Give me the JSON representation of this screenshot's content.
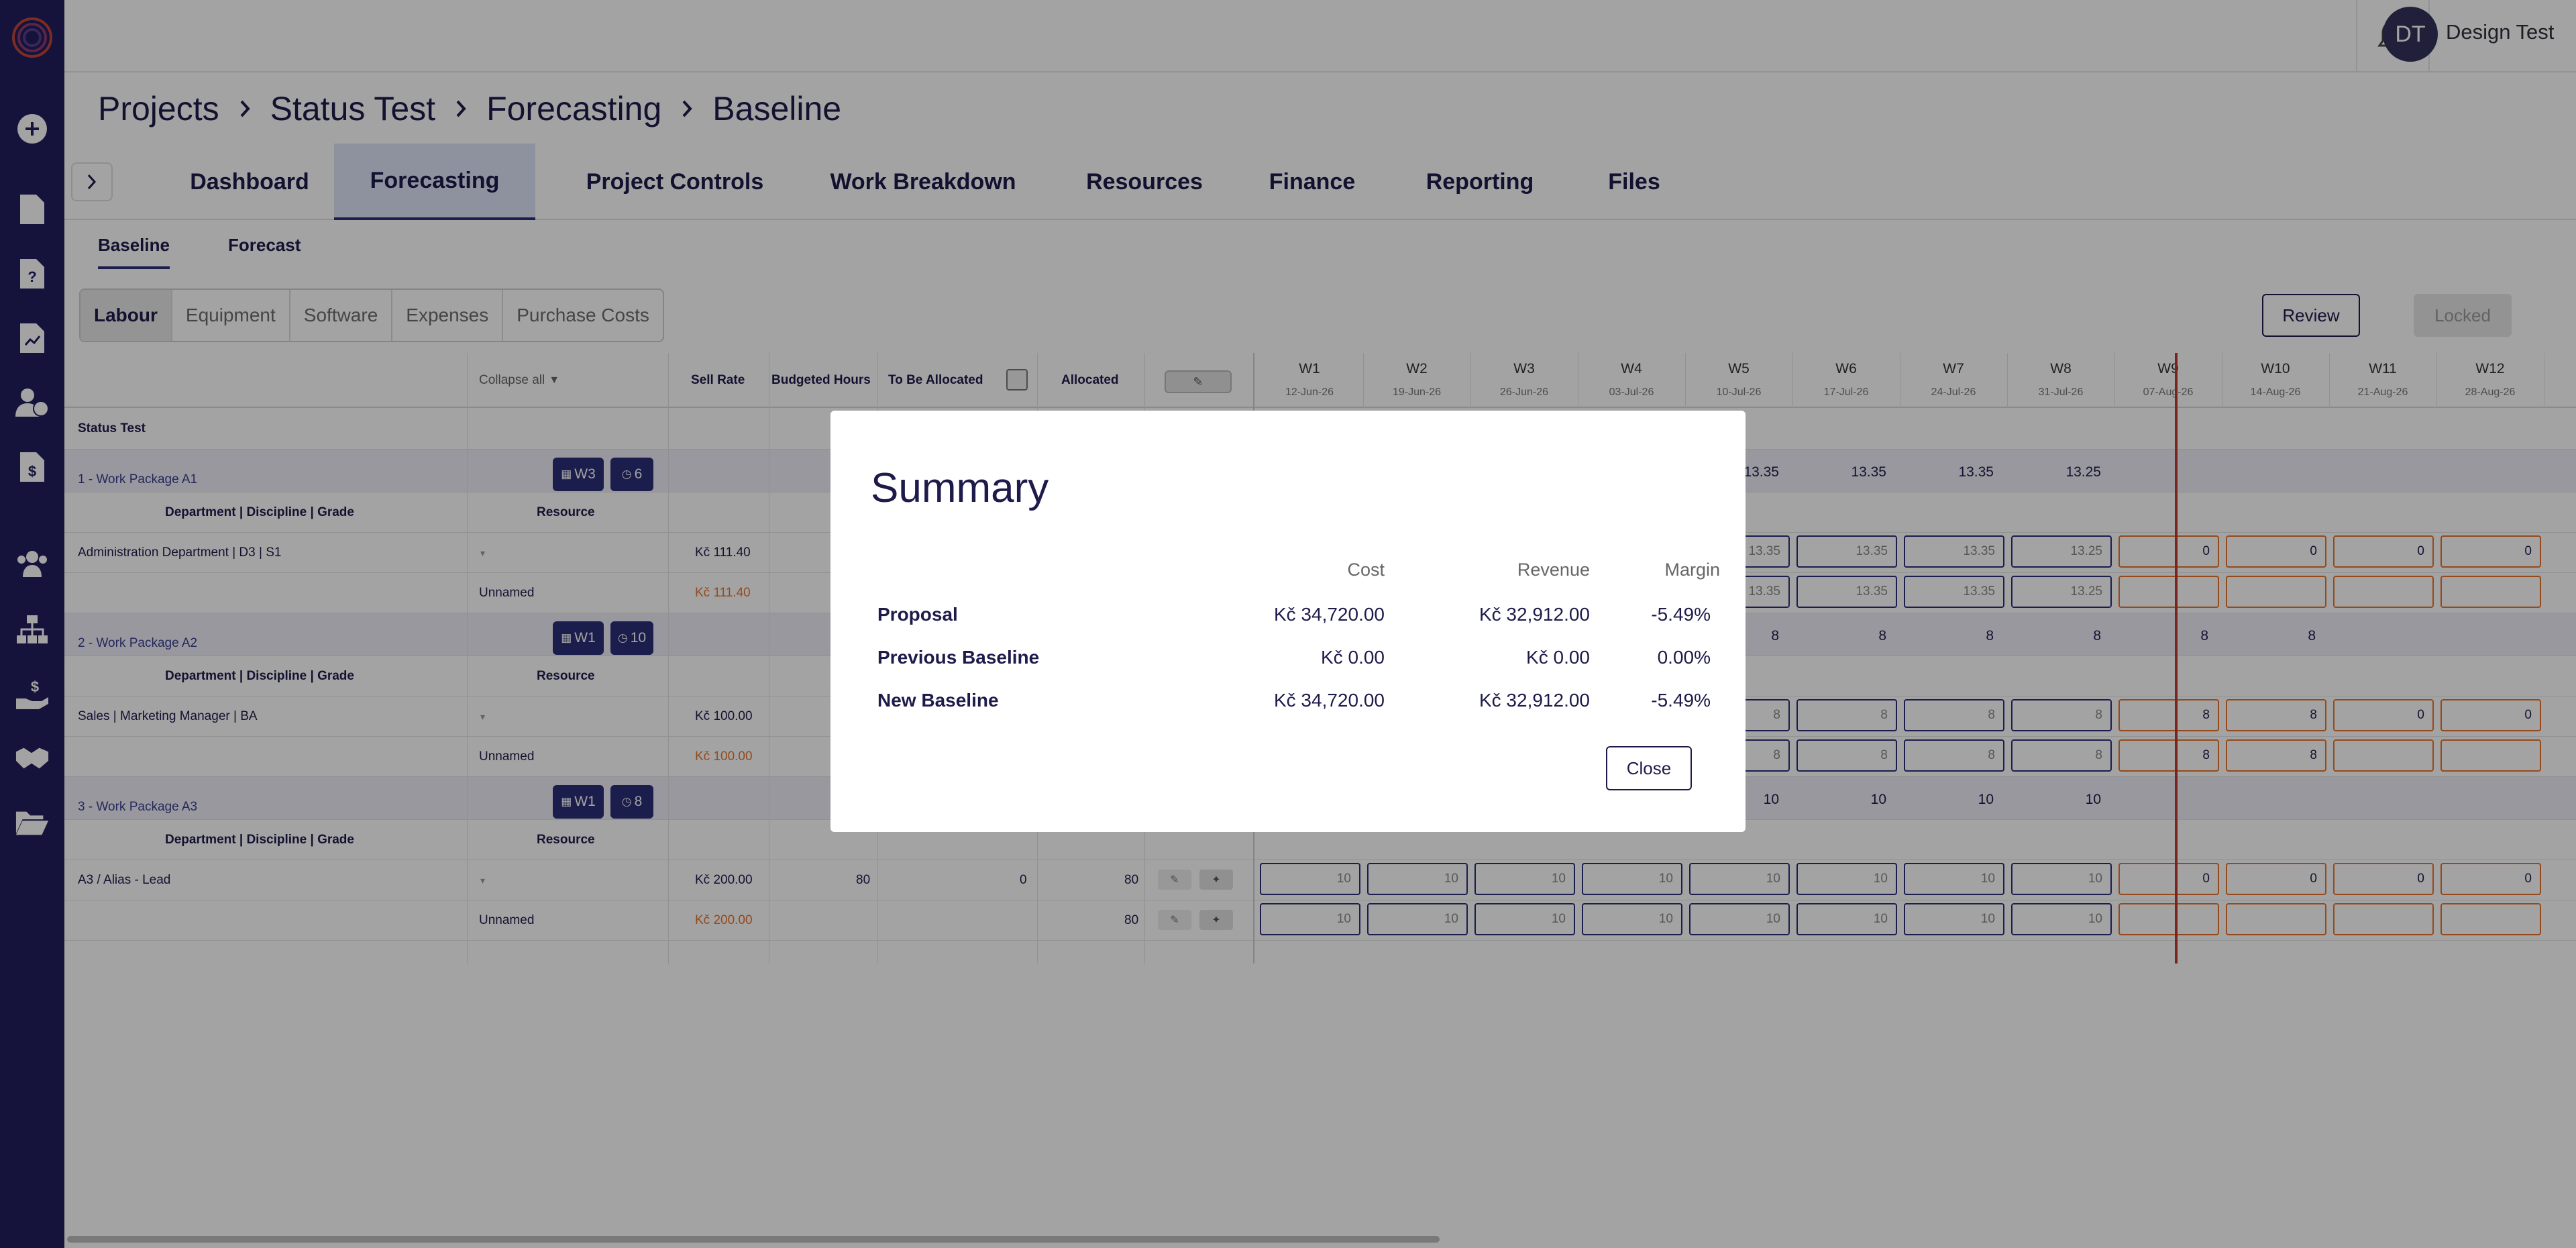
{
  "user": {
    "initials": "DT",
    "name": "Design Test"
  },
  "breadcrumb": [
    "Projects",
    "Status Test",
    "Forecasting",
    "Baseline"
  ],
  "tabs": [
    "Dashboard",
    "Forecasting",
    "Project Controls",
    "Work Breakdown",
    "Resources",
    "Finance",
    "Reporting",
    "Files"
  ],
  "active_tab": "Forecasting",
  "subtabs": [
    "Baseline",
    "Forecast"
  ],
  "segments": [
    "Labour",
    "Equipment",
    "Software",
    "Expenses",
    "Purchase Costs"
  ],
  "actions": {
    "review": "Review",
    "locked": "Locked"
  },
  "grid": {
    "collapse_all": "Collapse all",
    "headers": {
      "sell_rate": "Sell Rate",
      "budgeted_hours": "Budgeted Hours",
      "to_be_allocated": "To Be Allocated",
      "allocated": "Allocated"
    },
    "project": "Status Test",
    "weeks": [
      {
        "w": "W1",
        "d": "12-Jun-26"
      },
      {
        "w": "W2",
        "d": "19-Jun-26"
      },
      {
        "w": "W3",
        "d": "26-Jun-26"
      },
      {
        "w": "W4",
        "d": "03-Jul-26"
      },
      {
        "w": "W5",
        "d": "10-Jul-26"
      },
      {
        "w": "W6",
        "d": "17-Jul-26"
      },
      {
        "w": "W7",
        "d": "24-Jul-26"
      },
      {
        "w": "W8",
        "d": "31-Jul-26"
      },
      {
        "w": "W9",
        "d": "07-Aug-26"
      },
      {
        "w": "W10",
        "d": "14-Aug-26"
      },
      {
        "w": "W11",
        "d": "21-Aug-26"
      },
      {
        "w": "W12",
        "d": "28-Aug-26"
      }
    ],
    "subheaders": {
      "ddg": "Department | Discipline | Grade",
      "resource": "Resource"
    },
    "work_packages": [
      {
        "name": "1 - Work Package A1",
        "badge_week": "W3",
        "badge_count": "6",
        "line": "Administration Department | D3 | S1",
        "rate": "Kč 111.40",
        "unnamed": "Unnamed",
        "unnamed_rate": "Kč 111.40",
        "wp_vals": [
          "13.35",
          "13.35",
          "13.35",
          "13.25"
        ],
        "line_vals": [
          "13.35",
          "13.35",
          "13.35",
          "13.25",
          "0",
          "0",
          "0",
          "0"
        ],
        "unnamed_vals": [
          "13.35",
          "13.35",
          "13.35",
          "13.25"
        ]
      },
      {
        "name": "2 - Work Package A2",
        "badge_week": "W1",
        "badge_count": "10",
        "line": "Sales | Marketing Manager | BA",
        "rate": "Kč 100.00",
        "unnamed": "Unnamed",
        "unnamed_rate": "Kč 100.00",
        "wp_vals": [
          "8",
          "8",
          "8",
          "8",
          "8",
          "8"
        ],
        "line_vals": [
          "8",
          "8",
          "8",
          "8",
          "8",
          "8",
          "0",
          "0"
        ],
        "unnamed_vals": [
          "8",
          "8",
          "8",
          "8",
          "8",
          "8"
        ]
      },
      {
        "name": "3 - Work Package A3",
        "badge_week": "W1",
        "badge_count": "8",
        "line": "A3 / Alias - Lead",
        "rate": "Kč 200.00",
        "budgeted": "80",
        "to_alloc": "0",
        "allocated": "80",
        "unnamed": "Unnamed",
        "unnamed_rate": "Kč 200.00",
        "unnamed_allocated": "80",
        "wp_vals": [
          "10",
          "10",
          "10",
          "10"
        ],
        "line_vals": [
          "10",
          "10",
          "10",
          "10",
          "10",
          "10",
          "10",
          "10",
          "0",
          "0",
          "0",
          "0"
        ],
        "unnamed_vals": [
          "10",
          "10",
          "10",
          "10",
          "10",
          "10",
          "10",
          "10"
        ]
      }
    ]
  },
  "modal": {
    "title": "Summary",
    "columns": [
      "Cost",
      "Revenue",
      "Margin"
    ],
    "rows": [
      {
        "label": "Proposal",
        "cost": "Kč 34,720.00",
        "revenue": "Kč 32,912.00",
        "margin": "-5.49%"
      },
      {
        "label": "Previous Baseline",
        "cost": "Kč 0.00",
        "revenue": "Kč 0.00",
        "margin": "0.00%"
      },
      {
        "label": "New Baseline",
        "cost": "Kč 34,720.00",
        "revenue": "Kč 32,912.00",
        "margin": "-5.49%"
      }
    ],
    "close": "Close"
  },
  "colors": {
    "sidebar": "#221f5e",
    "accent": "#2b2f77",
    "future_week": "#e8742c",
    "today_line": "#c0392b",
    "rate_orange": "#e8742c"
  }
}
